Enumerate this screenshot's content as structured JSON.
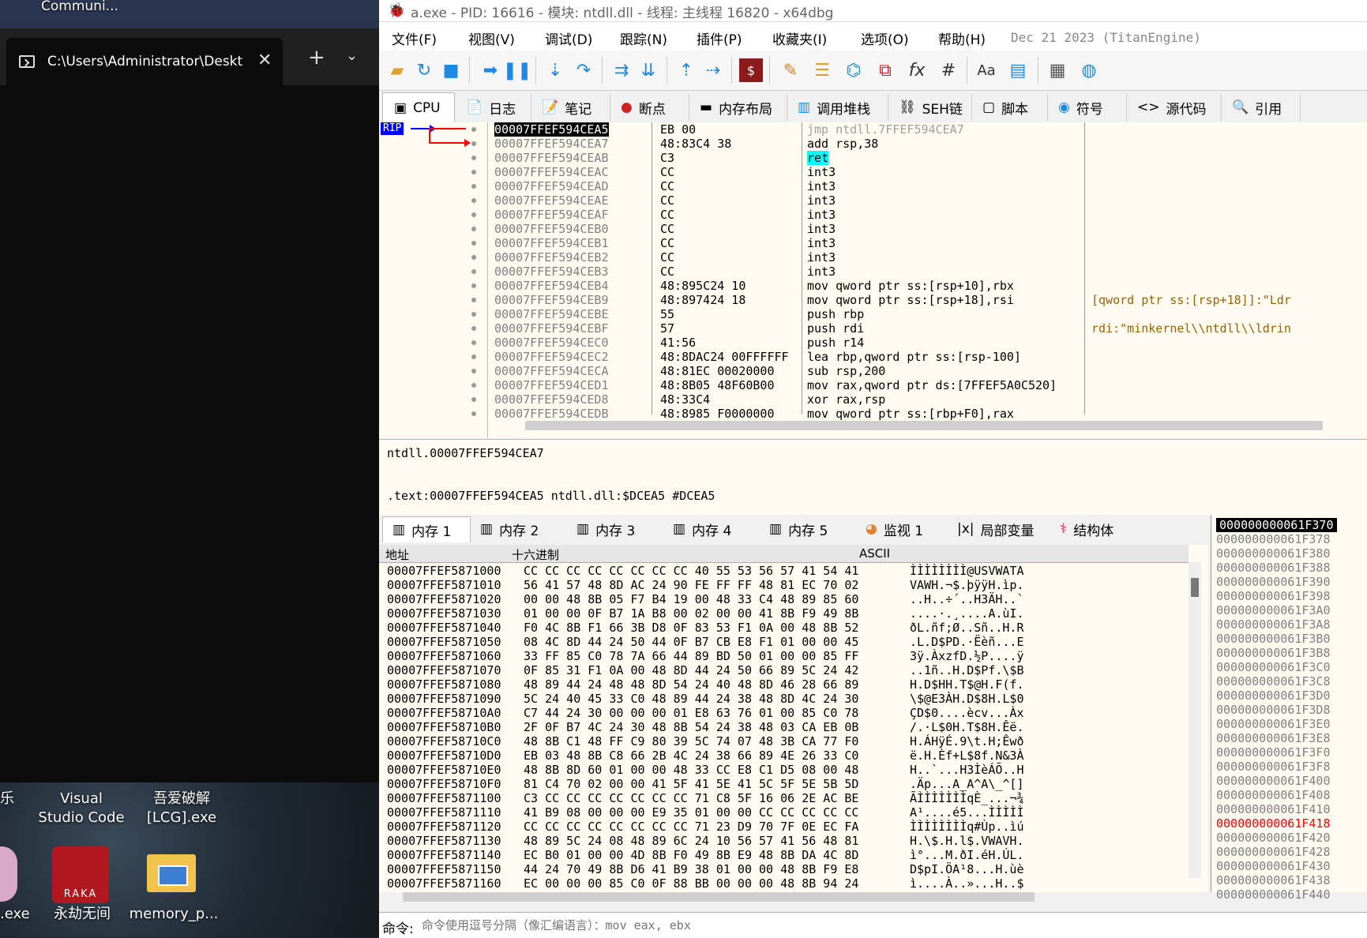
{
  "desktop": {
    "top_label": "Communi...",
    "terminal": {
      "tab_title": "C:\\Users\\Administrator\\Deskt",
      "close": "✕",
      "new_tab": "+",
      "dropdown": "⌄"
    },
    "icons": [
      {
        "label": "乐"
      },
      {
        "label": "Visual\nStudio Code"
      },
      {
        "label": "吾爱破解\n[LCG].exe"
      },
      {
        "label": ".exe"
      },
      {
        "label": "永劫无间"
      },
      {
        "label": "memory_p..."
      }
    ],
    "naraka_text": "RAKA"
  },
  "app": {
    "title": "a.exe - PID: 16616 - 模块: ntdll.dll - 线程: 主线程 16820 - x64dbg",
    "menu": [
      "文件(F)",
      "视图(V)",
      "调试(D)",
      "跟踪(N)",
      "插件(P)",
      "收藏夹(I)",
      "选项(O)",
      "帮助(H)"
    ],
    "menu_date": "Dec 21 2023 (TitanEngine)",
    "tabs": [
      "CPU",
      "日志",
      "笔记",
      "断点",
      "内存布局",
      "调用堆栈",
      "SEH链",
      "脚本",
      "符号",
      "源代码",
      "引用"
    ],
    "rip_label": "RIP",
    "cpu_rows": [
      {
        "addr": "00007FFEF594CEA5",
        "bytes": "EB 00",
        "dis": "jmp ntdll.7FFEF594CEA7",
        "cmt": ""
      },
      {
        "addr": "00007FFEF594CEA7",
        "bytes": "48:83C4 38",
        "dis": "add rsp,38",
        "cmt": ""
      },
      {
        "addr": "00007FFEF594CEAB",
        "bytes": "C3",
        "dis": "ret",
        "cmt": ""
      },
      {
        "addr": "00007FFEF594CEAC",
        "bytes": "CC",
        "dis": "int3",
        "cmt": ""
      },
      {
        "addr": "00007FFEF594CEAD",
        "bytes": "CC",
        "dis": "int3",
        "cmt": ""
      },
      {
        "addr": "00007FFEF594CEAE",
        "bytes": "CC",
        "dis": "int3",
        "cmt": ""
      },
      {
        "addr": "00007FFEF594CEAF",
        "bytes": "CC",
        "dis": "int3",
        "cmt": ""
      },
      {
        "addr": "00007FFEF594CEB0",
        "bytes": "CC",
        "dis": "int3",
        "cmt": ""
      },
      {
        "addr": "00007FFEF594CEB1",
        "bytes": "CC",
        "dis": "int3",
        "cmt": ""
      },
      {
        "addr": "00007FFEF594CEB2",
        "bytes": "CC",
        "dis": "int3",
        "cmt": ""
      },
      {
        "addr": "00007FFEF594CEB3",
        "bytes": "CC",
        "dis": "int3",
        "cmt": ""
      },
      {
        "addr": "00007FFEF594CEB4",
        "bytes": "48:895C24 10",
        "dis": "mov qword ptr ss:[rsp+10],rbx",
        "cmt": ""
      },
      {
        "addr": "00007FFEF594CEB9",
        "bytes": "48:897424 18",
        "dis": "mov qword ptr ss:[rsp+18],rsi",
        "cmt": "[qword ptr ss:[rsp+18]]:\"Ldr"
      },
      {
        "addr": "00007FFEF594CEBE",
        "bytes": "55",
        "dis": "push rbp",
        "cmt": ""
      },
      {
        "addr": "00007FFEF594CEBF",
        "bytes": "57",
        "dis": "push rdi",
        "cmt": "rdi:\"minkernel\\\\ntdll\\\\ldrin"
      },
      {
        "addr": "00007FFEF594CEC0",
        "bytes": "41:56",
        "dis": "push r14",
        "cmt": ""
      },
      {
        "addr": "00007FFEF594CEC2",
        "bytes": "48:8DAC24 00FFFFFF",
        "dis": "lea rbp,qword ptr ss:[rsp-100]",
        "cmt": ""
      },
      {
        "addr": "00007FFEF594CECA",
        "bytes": "48:81EC 00020000",
        "dis": "sub rsp,200",
        "cmt": ""
      },
      {
        "addr": "00007FFEF594CED1",
        "bytes": "48:8B05 48F60B00",
        "dis": "mov rax,qword ptr ds:[7FFEF5A0C520]",
        "cmt": ""
      },
      {
        "addr": "00007FFEF594CED8",
        "bytes": "48:33C4",
        "dis": "xor rax,rsp",
        "cmt": ""
      },
      {
        "addr": "00007FFEF594CEDB",
        "bytes": "48:8985 F0000000",
        "dis": "mov qword ptr ss:[rbp+F0],rax",
        "cmt": ""
      }
    ],
    "info_line1": "ntdll.00007FFEF594CEA7",
    "info_line2": ".text:00007FFEF594CEA5 ntdll.dll:$DCEA5 #DCEA5",
    "dump_tabs": [
      "内存 1",
      "内存 2",
      "内存 3",
      "内存 4",
      "内存 5",
      "监视 1",
      "局部变量",
      "结构体"
    ],
    "dump_head": {
      "addr": "地址",
      "hex": "十六进制",
      "ascii": "ASCII"
    },
    "dump_rows": [
      {
        "addr": "00007FFEF5871000",
        "hex": "CC CC CC CC  CC CC CC CC  40 55 53 56  57 41 54 41",
        "ascii": "ÌÌÌÌÌÌÌÌ@USVWATA"
      },
      {
        "addr": "00007FFEF5871010",
        "hex": "56 41 57 48  8D AC 24 90  FE FF FF 48  81 EC 70 02",
        "ascii": "VAWH.¬$.þÿÿH.ìp."
      },
      {
        "addr": "00007FFEF5871020",
        "hex": "00 00 48 8B  05 F7 B4 19  00 48 33 C4  48 89 85 60",
        "ascii": "..H..÷´..H3ÄH..`"
      },
      {
        "addr": "00007FFEF5871030",
        "hex": "01 00 00 0F  B7 1A B8 00  02 00 00 41  8B F9 49 8B",
        "ascii": "....·.¸....A.ùI."
      },
      {
        "addr": "00007FFEF5871040",
        "hex": "F0 4C 8B F1  66 3B D8 0F  83 53 F1 0A  00 48 8B 52",
        "ascii": "ðL.ñf;Ø..Sñ..H.R"
      },
      {
        "addr": "00007FFEF5871050",
        "hex": "08 4C 8D 44  24 50 44 0F  B7 CB E8 F1  01 00 00 45",
        "ascii": ".L.D$PD.·Ëèñ...E"
      },
      {
        "addr": "00007FFEF5871060",
        "hex": "33 FF 85 C0  78 7A 66 44  89 BD 50 01  00 00 85 FF",
        "ascii": "3ÿ.ÀxzfD.½P....ÿ"
      },
      {
        "addr": "00007FFEF5871070",
        "hex": "0F 85 31 F1  0A 00 48 8D  44 24 50 66  89 5C 24 42",
        "ascii": "..1ñ..H.D$Pf.\\$B"
      },
      {
        "addr": "00007FFEF5871080",
        "hex": "48 89 44 24  48 48 8D 54  24 40 48 8D  46 28 66 89",
        "ascii": "H.D$HH.T$@H.F(f."
      },
      {
        "addr": "00007FFEF5871090",
        "hex": "5C 24 40 45  33 C0 48 89  44 24 38 48  8D 4C 24 30",
        "ascii": "\\$@E3ÀH.D$8H.L$0"
      },
      {
        "addr": "00007FFEF58710A0",
        "hex": "C7 44 24 30  00 00 00 01  E8 63 76 01  00 85 C0 78",
        "ascii": "ÇD$0....ècv...Àx"
      },
      {
        "addr": "00007FFEF58710B0",
        "hex": "2F 0F B7 4C  24 30 48 8B  54 24 38 48  03 CA EB 0B",
        "ascii": "/.·L$0H.T$8H.Êë."
      },
      {
        "addr": "00007FFEF58710C0",
        "hex": "48 8B C1 48  FF C9 80 39  5C 74 07 48  3B CA 77 F0",
        "ascii": "H.ÁHÿÉ.9\\t.H;Êwð"
      },
      {
        "addr": "00007FFEF58710D0",
        "hex": "EB 03 48 8B  C8 66 2B 4C  24 38 66 89  4E 26 33 C0",
        "ascii": "ë.H.Èf+L$8f.N&3À"
      },
      {
        "addr": "00007FFEF58710E0",
        "hex": "48 8B 8D 60  01 00 00 48  33 CC E8 C1  D5 08 00 48",
        "ascii": "H..`...H3ÌèÁÕ..H"
      },
      {
        "addr": "00007FFEF58710F0",
        "hex": "81 C4 70 02  00 00 41 5F  41 5E 41 5C  5F 5E 5B 5D",
        "ascii": ".Äp...A_A^A\\_^[]"
      },
      {
        "addr": "00007FFEF5871100",
        "hex": "C3 CC CC CC  CC CC CC CC  71 C8 5F 16  06 2E AC BE",
        "ascii": "ÃÌÌÌÌÌÌÌqÈ_...¬¾"
      },
      {
        "addr": "00007FFEF5871110",
        "hex": "41 B9 08 00  00 00 E9 35  01 00 00 CC  CC CC CC CC",
        "ascii": "A¹....é5...ÌÌÌÌÌ"
      },
      {
        "addr": "00007FFEF5871120",
        "hex": "CC CC CC CC  CC CC CC CC  71 23 D9 70  7F 0E EC FA",
        "ascii": "ÌÌÌÌÌÌÌÌq#Ùp..ìú"
      },
      {
        "addr": "00007FFEF5871130",
        "hex": "48 89 5C 24  08 48 89 6C  24 10 56 57  41 56 48 81",
        "ascii": "H.\\$.H.l$.VWAVH."
      },
      {
        "addr": "00007FFEF5871140",
        "hex": "EC B0 01 00  00 4D 8B F0  49 8B E9 48  8B DA 4C 8D",
        "ascii": "ì°...M.ðI.éH.ÚL."
      },
      {
        "addr": "00007FFEF5871150",
        "hex": "44 24 70 49  8B D6 41 B9  38 01 00 00  48 8B F9 E8",
        "ascii": "D$pI.ÖA¹8...H.ùè"
      },
      {
        "addr": "00007FFEF5871160",
        "hex": "EC 00 00 00  85 C0 0F 88  BB 00 00 00  48 8B 94 24",
        "ascii": "ì....À..»...H..$"
      }
    ],
    "stack_rows": [
      "000000000061F370",
      "000000000061F378",
      "000000000061F380",
      "000000000061F388",
      "000000000061F390",
      "000000000061F398",
      "000000000061F3A0",
      "000000000061F3A8",
      "000000000061F3B0",
      "000000000061F3B8",
      "000000000061F3C0",
      "000000000061F3C8",
      "000000000061F3D0",
      "000000000061F3D8",
      "000000000061F3E0",
      "000000000061F3E8",
      "000000000061F3F0",
      "000000000061F3F8",
      "000000000061F400",
      "000000000061F408",
      "000000000061F410",
      "000000000061F418",
      "000000000061F420",
      "000000000061F428",
      "000000000061F430",
      "000000000061F438",
      "000000000061F440"
    ],
    "cmd_label": "命令:",
    "cmd_placeholder": "命令使用逗号分隔（像汇编语言）：mov eax, ebx",
    "colors": {
      "rip_blue": "#0000ff",
      "arrow_red": "#ff0000",
      "highlight_yellow": "#ffff00",
      "highlight_cyan": "#00ffff",
      "stack_red": "#ff0000"
    }
  }
}
